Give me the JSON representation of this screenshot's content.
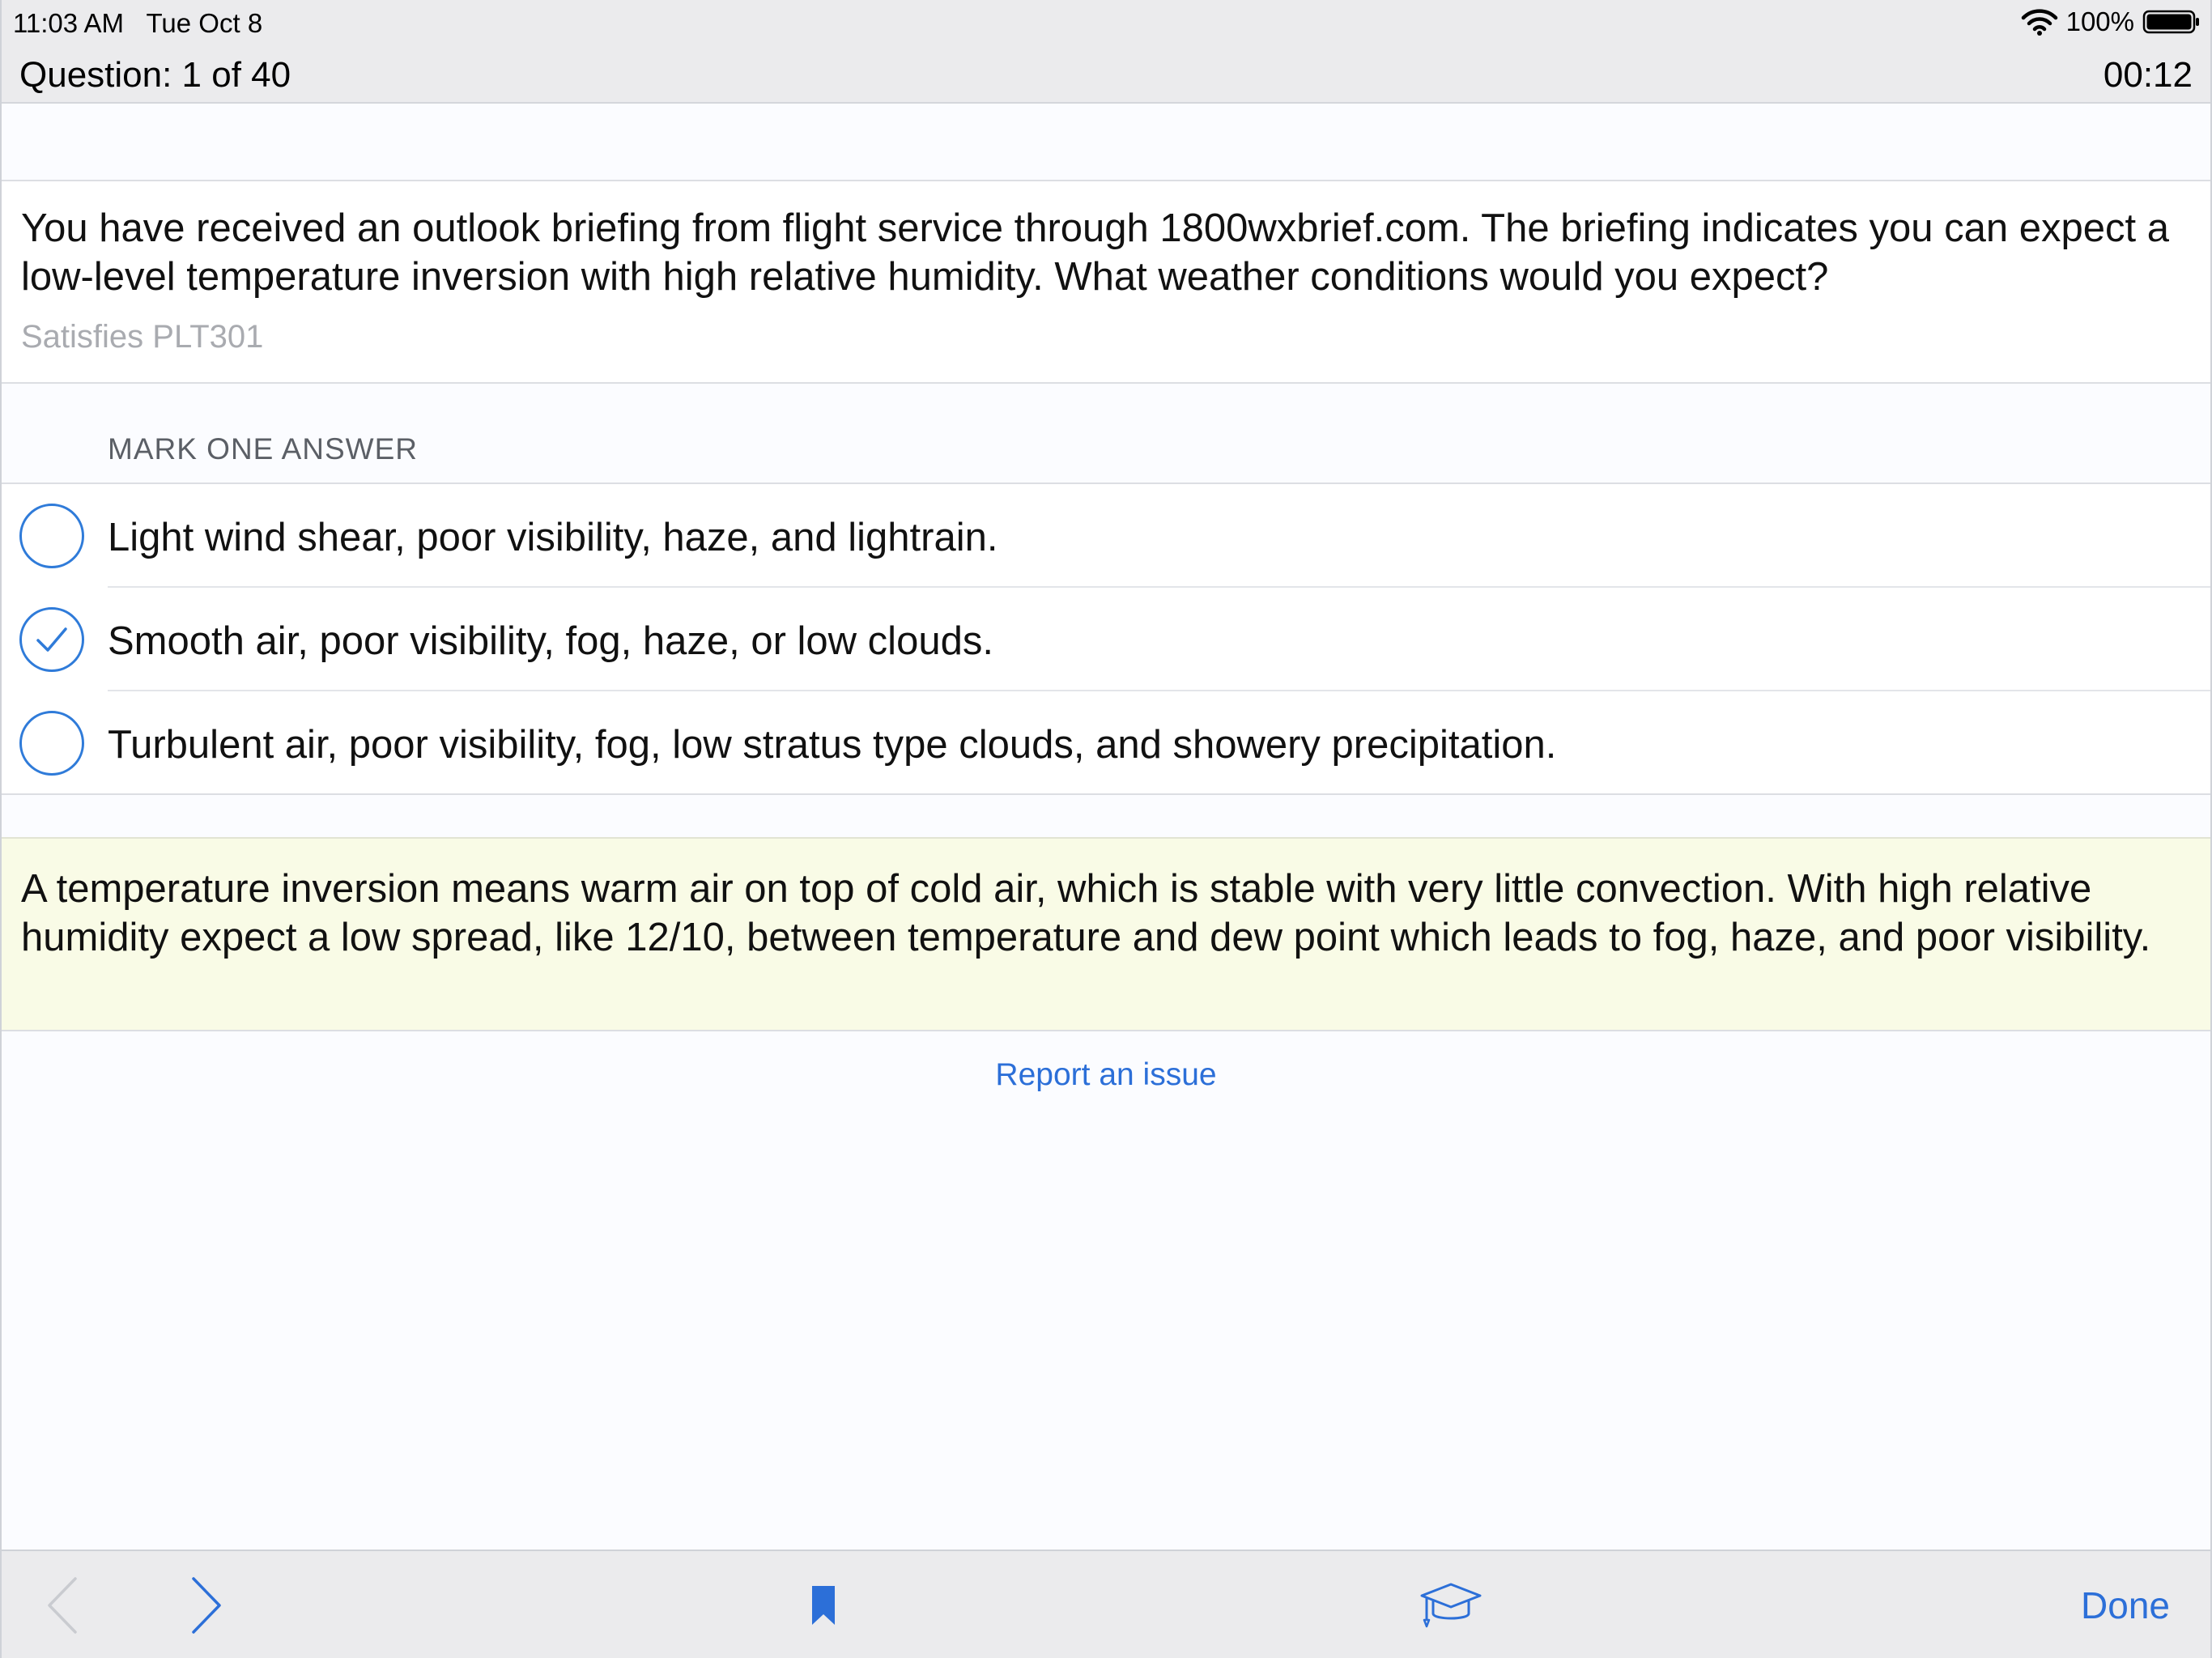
{
  "status_bar": {
    "time": "11:03 AM",
    "date": "Tue Oct 8",
    "battery": "100%"
  },
  "header": {
    "question_counter": "Question: 1 of 40",
    "timer": "00:12"
  },
  "question": {
    "text": "You have received an outlook briefing from flight service through 1800wxbrief.com. The briefing indicates you can expect a low-level temperature inversion with high relative humidity. What weather conditions would you expect?",
    "objective": "Satisfies PLT301"
  },
  "answers_section": {
    "label": "MARK ONE ANSWER",
    "selected_index": 1,
    "options": [
      "Light wind shear, poor visibility, haze, and lightrain.",
      "Smooth air, poor visibility, fog, haze, or low clouds.",
      "Turbulent air, poor visibility, fog, low stratus type clouds, and showery precipitation."
    ]
  },
  "explanation": {
    "text": "A temperature inversion means warm air on top of cold air, which is stable with very little convection. With high relative humidity expect a low spread, like 12/10, between temperature and dew point which leads to fog, haze, and poor visibility."
  },
  "report_link": "Report an issue",
  "toolbar": {
    "done_label": "Done",
    "icons": [
      "chevron-left-icon",
      "chevron-right-icon",
      "bookmark-icon",
      "graduation-cap-icon"
    ]
  },
  "colors": {
    "accent": "#2c6fd8",
    "radio": "#2f7bd9",
    "explanation_bg": "#f9fbe6",
    "bar_bg": "#ebebed"
  }
}
